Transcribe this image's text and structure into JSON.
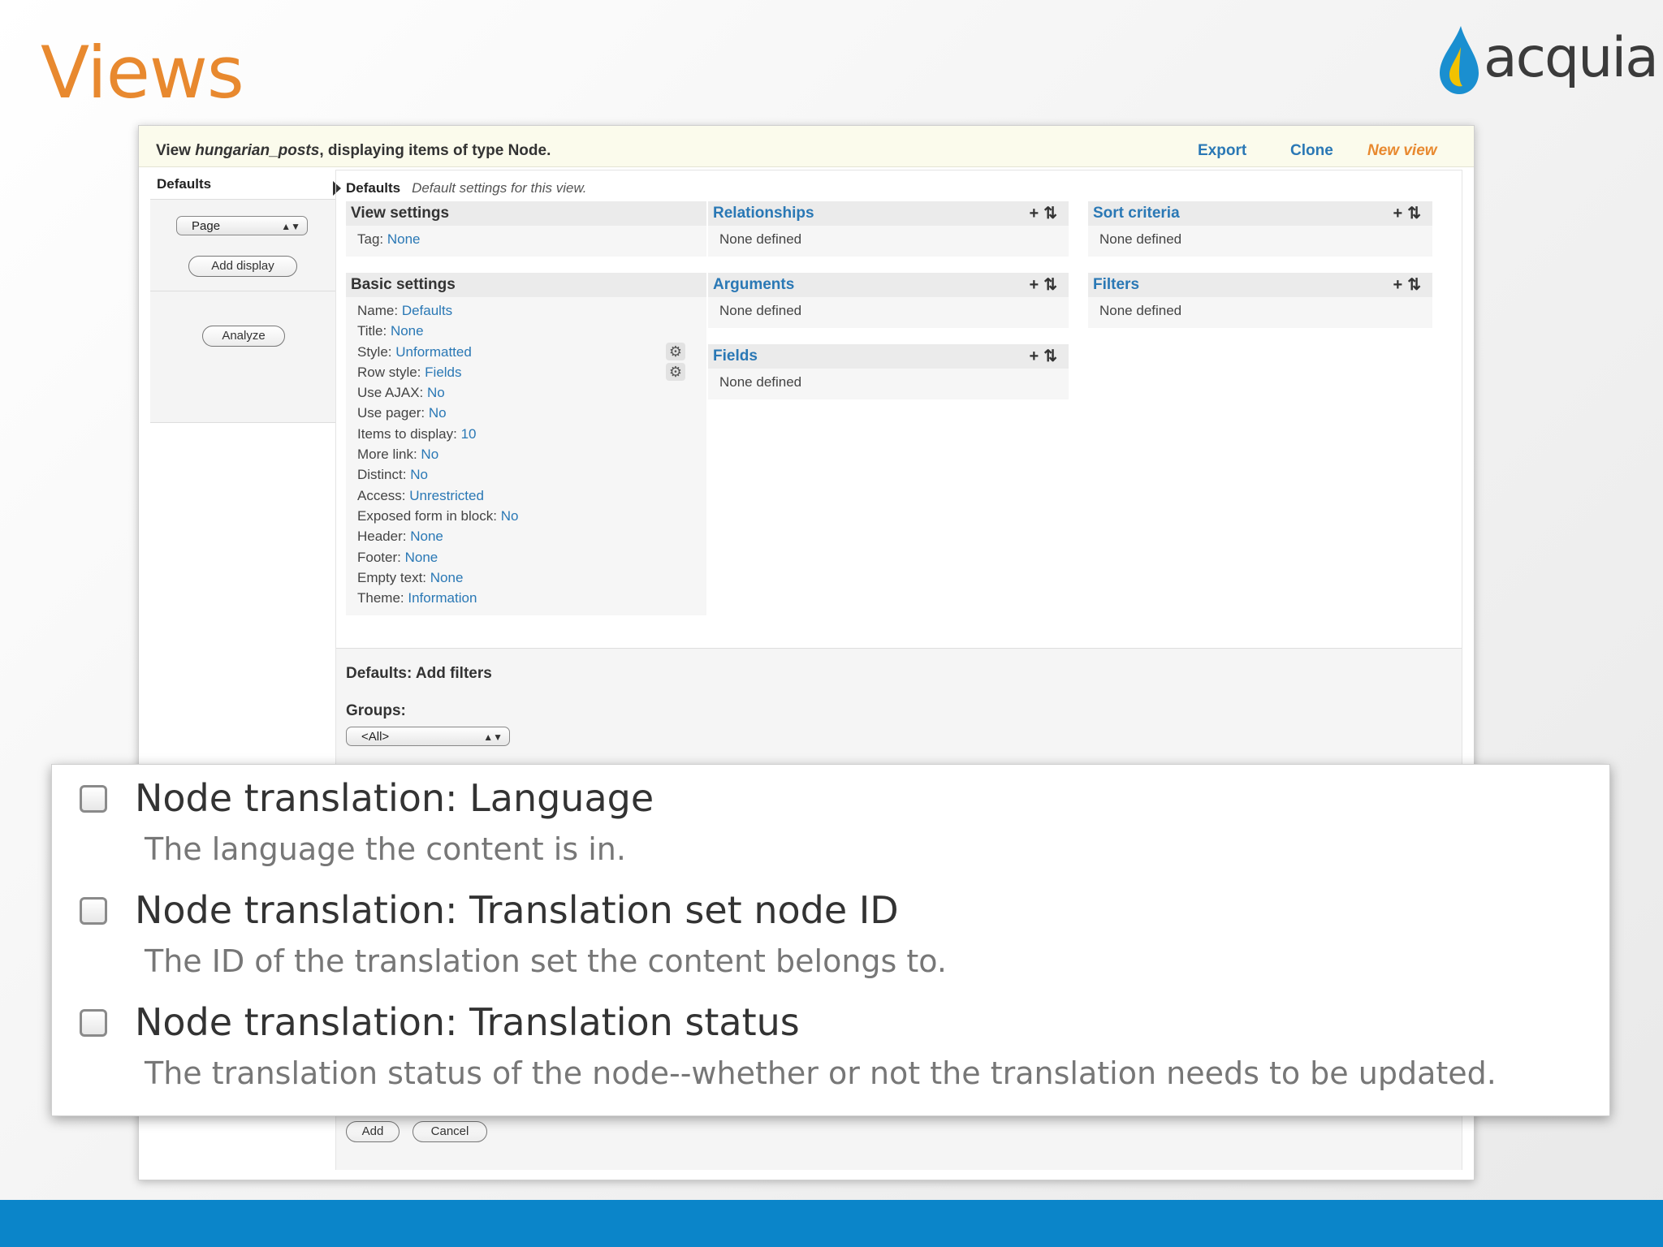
{
  "slide": {
    "title": "Views",
    "logo_text": "acquia"
  },
  "view_header": {
    "prefix": "View ",
    "view_name": "hungarian_posts",
    "suffix": ", displaying items of type Node.",
    "links": {
      "export": "Export",
      "clone": "Clone",
      "new_view": "New view"
    }
  },
  "displays": {
    "active_tab": "Defaults",
    "select_value": "Page",
    "add_display": "Add display",
    "analyze": "Analyze"
  },
  "defaults_line": {
    "label": "Defaults",
    "description": "Default settings for this view."
  },
  "view_settings": {
    "title": "View settings",
    "rows": [
      {
        "key": "Tag:",
        "value": "None"
      }
    ]
  },
  "basic_settings": {
    "title": "Basic settings",
    "rows": [
      {
        "key": "Name:",
        "value": "Defaults"
      },
      {
        "key": "Title:",
        "value": "None"
      },
      {
        "key": "Style:",
        "value": "Unformatted"
      },
      {
        "key": "Row style:",
        "value": "Fields"
      },
      {
        "key": "Use AJAX:",
        "value": "No"
      },
      {
        "key": "Use pager:",
        "value": "No"
      },
      {
        "key": "Items to display:",
        "value": "10"
      },
      {
        "key": "More link:",
        "value": "No"
      },
      {
        "key": "Distinct:",
        "value": "No"
      },
      {
        "key": "Access:",
        "value": "Unrestricted"
      },
      {
        "key": "Exposed form in block:",
        "value": "No"
      },
      {
        "key": "Header:",
        "value": "None"
      },
      {
        "key": "Footer:",
        "value": "None"
      },
      {
        "key": "Empty text:",
        "value": "None"
      },
      {
        "key": "Theme:",
        "value": "Information"
      }
    ]
  },
  "sections": {
    "relationships": {
      "title": "Relationships",
      "empty": "None defined"
    },
    "arguments": {
      "title": "Arguments",
      "empty": "None defined"
    },
    "fields": {
      "title": "Fields",
      "empty": "None defined"
    },
    "sort_criteria": {
      "title": "Sort criteria",
      "empty": "None defined"
    },
    "filters": {
      "title": "Filters",
      "empty": "None defined"
    }
  },
  "add_filters": {
    "title": "Defaults: Add filters",
    "groups_label": "Groups:",
    "groups_value": "<All>",
    "add_button": "Add",
    "cancel_button": "Cancel"
  },
  "zoom_options": [
    {
      "label": "Node translation: Language",
      "description": "The language the content is in."
    },
    {
      "label": "Node translation: Translation set node ID",
      "description": "The ID of the translation set the content belongs to."
    },
    {
      "label": "Node translation: Translation status",
      "description": "The translation status of the node--whether or not the translation needs to be updated."
    }
  ],
  "colors": {
    "title_orange": "#e8892f",
    "link_blue": "#2a78b5",
    "bar_blue": "#0b85c9"
  }
}
